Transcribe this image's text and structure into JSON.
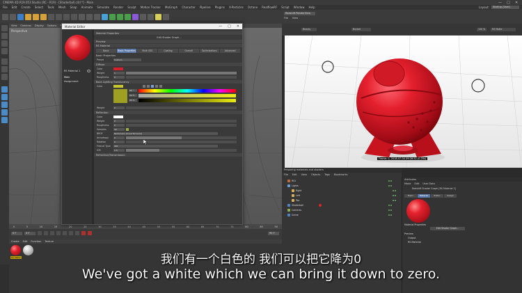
{
  "app": {
    "title": "CINEMA 4D R19.053 Studio (RC - R19) - [Shaderball.c4d *] - Main",
    "window_controls": [
      "—",
      "□",
      "✕"
    ]
  },
  "menubar": {
    "items": [
      "File",
      "Edit",
      "Create",
      "Select",
      "Tools",
      "Mesh",
      "Snap",
      "Animate",
      "Simulate",
      "Render",
      "Sculpt",
      "Motion Tracker",
      "MoGraph",
      "Character",
      "Pipeline",
      "Plugins",
      "X-Particles",
      "Octane",
      "RealflowRF",
      "Script",
      "Window",
      "Help"
    ],
    "layout_label": "Layout:",
    "layout_value": "Startup (User)"
  },
  "viewport_left": {
    "menu": [
      "View",
      "Cameras",
      "Display",
      "Options",
      "Filter",
      "Panel"
    ],
    "name": "Perspective",
    "grid_spacing": "Grid Spacing : 10 cm"
  },
  "timeline": {
    "ticks": [
      "0",
      "5",
      "10",
      "15",
      "20",
      "25",
      "30",
      "35",
      "40",
      "45",
      "50",
      "55",
      "60",
      "65",
      "70",
      "75",
      "80",
      "85",
      "90"
    ],
    "start_frame": "0 F",
    "current_frame": "0 F",
    "end_frame": "90 F"
  },
  "material_manager": {
    "menu": [
      "Create",
      "Edit",
      "Function",
      "Texture"
    ],
    "material_label": "RS Materi"
  },
  "material_editor": {
    "title": "Material Editor",
    "material_name": "RS Material 1",
    "channels": [
      "Main",
      "Assignment"
    ],
    "header_rows": {
      "properties": "Material Properties",
      "edit_graph": "Edit Shader Graph...",
      "preview": "Preview",
      "material": "RS Material"
    },
    "tabs": [
      "Basic",
      "Basic Properties",
      "Multi SSS",
      "Coating",
      "Overall",
      "Optimizations",
      "Advanced"
    ],
    "basic_properties": "Basic Properties",
    "preset_label": "Preset",
    "preset_value": "Custom",
    "diffuse": {
      "section": "Diffuse",
      "color_label": "Color",
      "weight_label": "Weight",
      "weight_value": "1",
      "roughness_label": "Roughness",
      "roughness_value": "0"
    },
    "backlighting": {
      "section": "Back Lighting Translucency",
      "color_label": "Color",
      "h_value": "60 °",
      "s_value": "94 %",
      "v_value": "94 %",
      "weight_label": "Weight",
      "weight_value": "0"
    },
    "reflection": {
      "section": "Reflection",
      "color_label": "Color",
      "weight_label": "Weight",
      "weight_value": "0",
      "roughness_label": "Roughness",
      "roughness_value": "0",
      "samples_label": "Samples",
      "samples_value": "16",
      "brdf_label": "BRDF",
      "brdf_value": "Beckmann (Cook-Torrance)",
      "anisotropy_label": "Anisotropy",
      "anisotropy_value": "0",
      "rotation_label": "Rotation",
      "rotation_value": "0",
      "fresnel_label": "Fresnel Type",
      "fresnel_value": "IOR",
      "ior_label": "IOR",
      "ior_value": "1.5"
    },
    "refraction_section": "Refraction/Transmission"
  },
  "render_view": {
    "title": "Redshift RenderView",
    "menu": [
      "File",
      "View"
    ],
    "toolbar": [
      "Beauty",
      "Bucket",
      "100 %",
      "RS Matte"
    ],
    "stamp": "Frame: 0, 2018-07-04 09:28:52 (0.20s)"
  },
  "object_manager": {
    "header": "Preparing materials and shaders",
    "menu": [
      "File",
      "Edit",
      "View",
      "Objects",
      "Tags",
      "Bookmarks"
    ],
    "objects": [
      {
        "name": "RS1",
        "color": "#c56b3d",
        "indent": 0
      },
      {
        "name": "Lights",
        "color": "#6aa0d8",
        "indent": 0
      },
      {
        "name": "Right",
        "color": "#d9b35c",
        "indent": 1
      },
      {
        "name": "Left",
        "color": "#d9b35c",
        "indent": 1
      },
      {
        "name": "Top",
        "color": "#d9b35c",
        "indent": 1
      },
      {
        "name": "Shaderball",
        "color": "#4f86c6",
        "indent": 0
      },
      {
        "name": "Cameras",
        "color": "#8fb04f",
        "indent": 0
      },
      {
        "name": "Scene",
        "color": "#4f86c6",
        "indent": 0
      }
    ]
  },
  "attributes": {
    "title": "Attributes",
    "menu": [
      "Mode",
      "Edit",
      "User Data"
    ],
    "material_title": "Redshift Shader Graph [RS Material 1]",
    "tabs": [
      "Basic",
      "Material",
      "Editor",
      "Assign"
    ],
    "material_properties": "Material Properties",
    "edit_graph": "Edit Shader Graph...",
    "preview_section": "Preview",
    "output_row": "Output",
    "rs_material_row": "RS Material"
  },
  "subtitles": {
    "chinese": "我们有一个白色的 我们可以把它降为0",
    "english": "We've got a white which we can bring it down to zero."
  }
}
